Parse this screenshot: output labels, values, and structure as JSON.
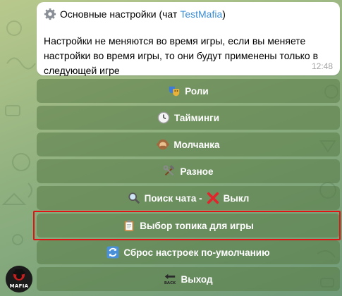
{
  "message": {
    "title_prefix": "Основные настройки (чат",
    "chat_name": "TestMafia",
    "title_suffix": ")",
    "body": "Настройки не меняются во время игры, если вы меняете настройки во время игры, то они будут применены только в следующей игре",
    "time": "12:48"
  },
  "keyboard": {
    "roles": "Роли",
    "timings": "Тайминги",
    "silence": "Молчанка",
    "misc": "Разное",
    "search_prefix": "Поиск чата -",
    "search_value": "Выкл",
    "topic": "Выбор топика для игры",
    "reset": "Сброс настроек по-умолчанию",
    "exit": "Выход"
  },
  "logo": {
    "text": "MAFIA"
  },
  "colors": {
    "highlight": "#e01414",
    "link": "#3a8ed4",
    "button_bg": "#587a46"
  }
}
